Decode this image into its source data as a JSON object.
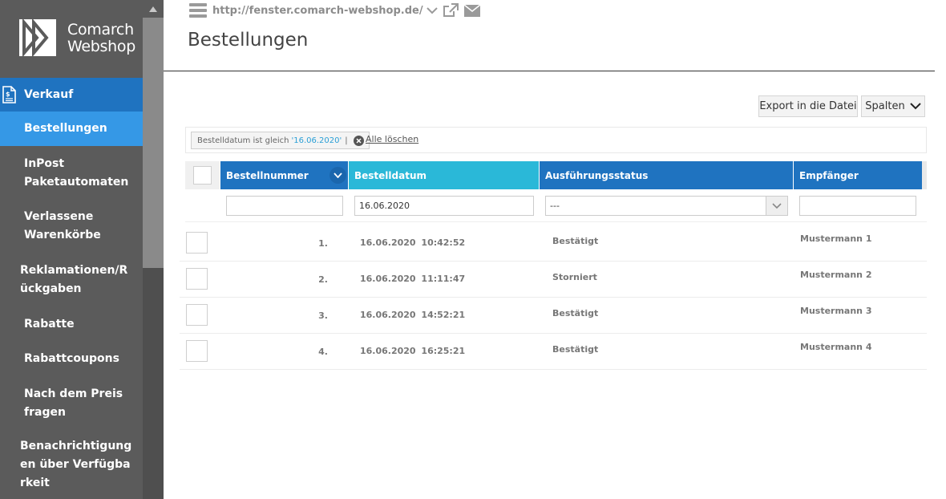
{
  "brand": {
    "line1": "Comarch",
    "line2": "Webshop"
  },
  "sidebar": {
    "section": {
      "label": "Verkauf",
      "icon": "document-dollar-icon"
    },
    "items": [
      {
        "label": "Bestellungen",
        "active": true
      },
      {
        "label": "InPost Paketautomaten"
      },
      {
        "label": "Verlassene Warenkörbe"
      },
      {
        "label": "Reklamationen/Rückgaben"
      },
      {
        "label": "Rabatte"
      },
      {
        "label": "Rabattcoupons"
      },
      {
        "label": "Nach dem Preis fragen"
      },
      {
        "label": "Benachrichtigungen über Verfügbarkeit"
      }
    ]
  },
  "header": {
    "url": "http://fenster.comarch-webshop.de/",
    "title": "Bestellungen"
  },
  "toolbar": {
    "export_label": "Export in die Datei",
    "columns_label": "Spalten"
  },
  "filters": {
    "chip_label": "Bestelldatum ist gleich",
    "chip_value": "'16.06.2020'",
    "chip_sep": "|",
    "clear_all": "Alle löschen"
  },
  "table": {
    "headers": [
      "Bestellnummer",
      "Bestelldatum",
      "Ausführungsstatus",
      "Empfänger"
    ],
    "filter_values": {
      "nr": "",
      "date": "16.06.2020",
      "status": "---",
      "recipient": ""
    },
    "rows": [
      {
        "nr": "1.",
        "date": "16.06.2020  10:42:52",
        "status": "Bestätigt",
        "recipient": "Mustermann 1"
      },
      {
        "nr": "2.",
        "date": "16.06.2020  11:11:47",
        "status": "Storniert",
        "recipient": "Mustermann 2"
      },
      {
        "nr": "3.",
        "date": "16.06.2020  14:52:21",
        "status": "Bestätigt",
        "recipient": "Mustermann 3"
      },
      {
        "nr": "4.",
        "date": "16.06.2020  16:25:21",
        "status": "Bestätigt",
        "recipient": "Mustermann 4"
      }
    ]
  },
  "colors": {
    "primary": "#1f73c0",
    "active_item": "#3598e6",
    "sort_column": "#2ab8d8",
    "sidebar_bg": "#5b5b5b"
  }
}
